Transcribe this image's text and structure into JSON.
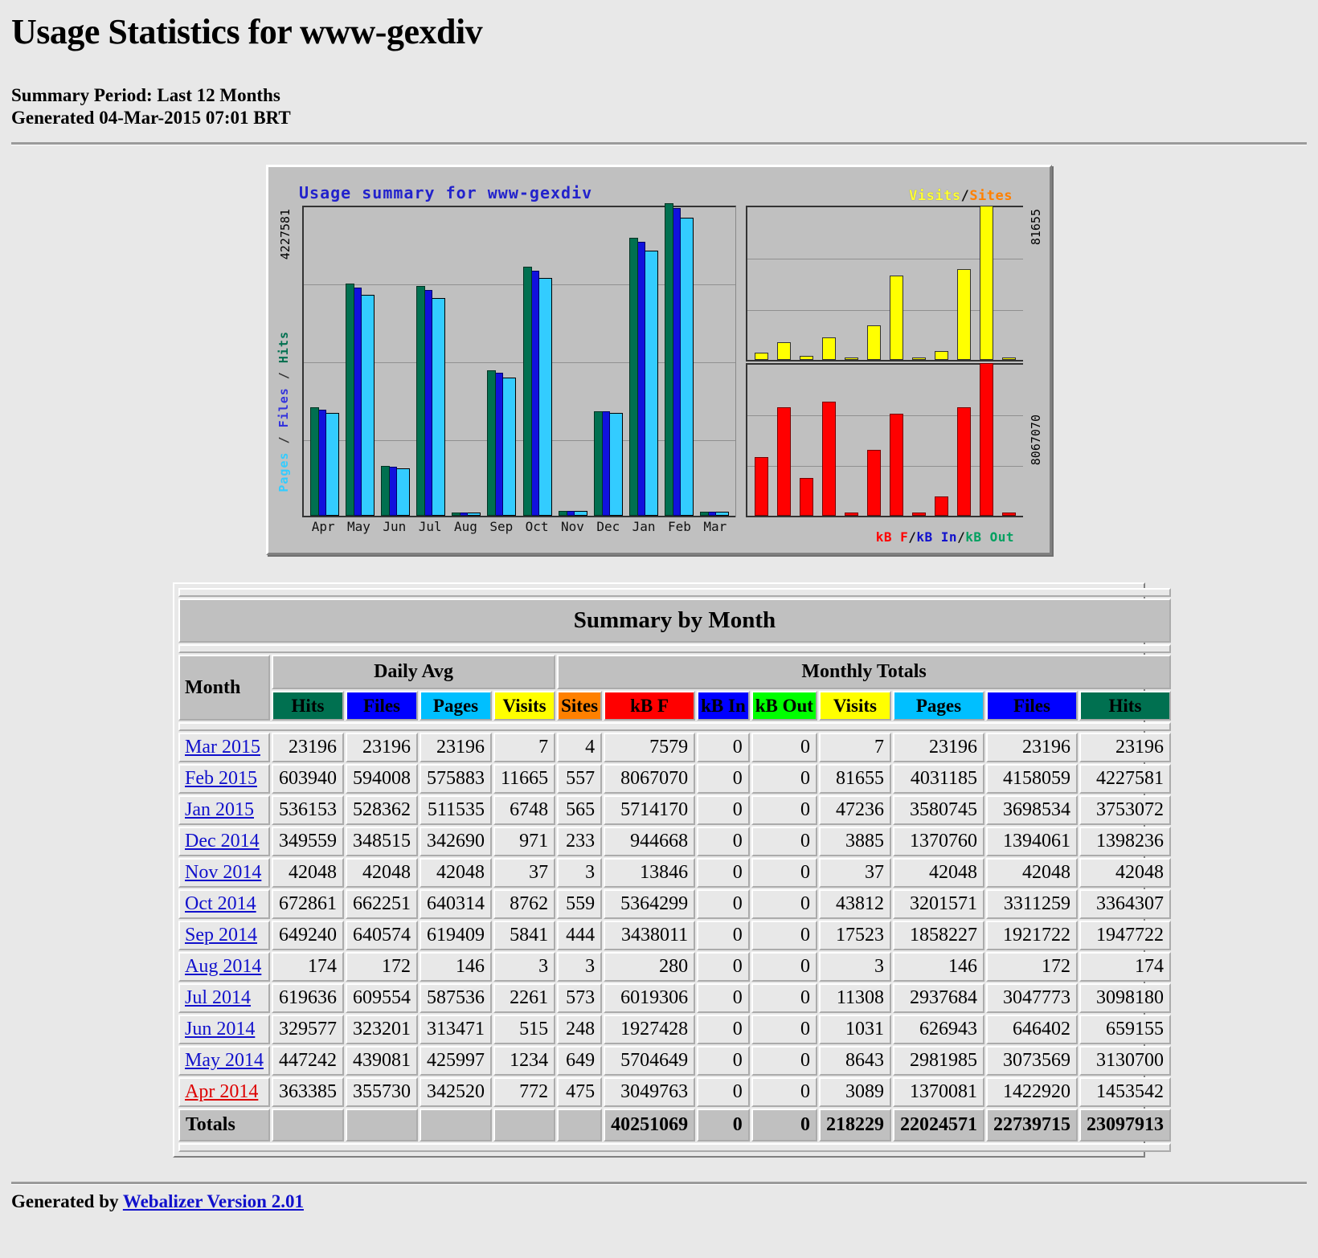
{
  "page": {
    "title": "Usage Statistics for www-gexdiv",
    "summary_period": "Summary Period: Last 12 Months",
    "generated": "Generated 04-Mar-2015 07:01 BRT"
  },
  "chart": {
    "title": "Usage summary for www-gexdiv",
    "legend_visits": "Visits",
    "legend_sep": "/",
    "legend_sites": "Sites",
    "legend_kbf": "kB F",
    "legend_kbin": "kB In",
    "legend_kbout": "kB Out",
    "ylabel_pages": "Pages",
    "ylabel_files": "Files",
    "ylabel_hits": "Hits",
    "ylabel_sep": " / ",
    "ymax_left": "4227581",
    "ymax_right_top": "81655",
    "ymax_right_bottom": "8067070"
  },
  "chart_data": {
    "type": "bar",
    "title": "Usage summary for www-gexdiv",
    "xlabel": "",
    "ylabel": "Pages / Files / Hits",
    "categories": [
      "Apr",
      "May",
      "Jun",
      "Jul",
      "Aug",
      "Sep",
      "Oct",
      "Nov",
      "Dec",
      "Jan",
      "Feb",
      "Mar"
    ],
    "grid": true,
    "legend_position": "top-right",
    "panels": [
      {
        "name": "Pages / Files / Hits",
        "ylim": [
          0,
          4227581
        ],
        "series": [
          {
            "name": "Hits",
            "color": "#007050",
            "values": [
              1453542,
              3130700,
              659155,
              3098180,
              174,
              1947722,
              3364307,
              42048,
              1398236,
              3753072,
              4227581,
              23196
            ]
          },
          {
            "name": "Files",
            "color": "#1111DD",
            "values": [
              1422920,
              3073569,
              646402,
              3047773,
              172,
              1921722,
              3311259,
              42048,
              1394061,
              3698534,
              4158059,
              23196
            ]
          },
          {
            "name": "Pages",
            "color": "#33CCFF",
            "values": [
              1370081,
              2981985,
              626943,
              2937684,
              146,
              1858227,
              3201571,
              42048,
              1370760,
              3580745,
              4031185,
              23196
            ]
          }
        ]
      },
      {
        "name": "Visits / Sites",
        "ylim": [
          0,
          81655
        ],
        "series": [
          {
            "name": "Visits",
            "color": "#FFFF00",
            "values": [
              3089,
              8643,
              1031,
              11308,
              3,
              17523,
              43812,
              37,
              3885,
              47236,
              81655,
              7
            ]
          },
          {
            "name": "Sites",
            "color": "#FF8000",
            "values": [
              475,
              649,
              248,
              573,
              3,
              444,
              559,
              3,
              233,
              565,
              557,
              4
            ]
          }
        ]
      },
      {
        "name": "kB F / kB In / kB Out",
        "ylim": [
          0,
          8067070
        ],
        "series": [
          {
            "name": "kB F",
            "color": "#FF0000",
            "values": [
              3049763,
              5704649,
              1927428,
              6019306,
              280,
              3438011,
              5364299,
              13846,
              944668,
              5714170,
              8067070,
              7579
            ]
          },
          {
            "name": "kB In",
            "color": "#1111CC",
            "values": [
              0,
              0,
              0,
              0,
              0,
              0,
              0,
              0,
              0,
              0,
              0,
              0
            ]
          },
          {
            "name": "kB Out",
            "color": "#00A060",
            "values": [
              0,
              0,
              0,
              0,
              0,
              0,
              0,
              0,
              0,
              0,
              0,
              0
            ]
          }
        ]
      }
    ]
  },
  "table": {
    "caption": "Summary by Month",
    "group_headers": {
      "daily_avg": "Daily Avg",
      "monthly_totals": "Monthly Totals"
    },
    "month_header": "Month",
    "columns": [
      {
        "label": "Hits",
        "bg": "#007050",
        "fg": "#000000"
      },
      {
        "label": "Files",
        "bg": "#0000FF",
        "fg": "#000000"
      },
      {
        "label": "Pages",
        "bg": "#00BFFF",
        "fg": "#000000"
      },
      {
        "label": "Visits",
        "bg": "#FFFF00",
        "fg": "#000000"
      },
      {
        "label": "Sites",
        "bg": "#FF8000",
        "fg": "#000000"
      },
      {
        "label": "kB F",
        "bg": "#FF0000",
        "fg": "#000000"
      },
      {
        "label": "kB In",
        "bg": "#0000FF",
        "fg": "#000000"
      },
      {
        "label": "kB Out",
        "bg": "#00FF00",
        "fg": "#000000"
      },
      {
        "label": "Visits",
        "bg": "#FFFF00",
        "fg": "#000000"
      },
      {
        "label": "Pages",
        "bg": "#00BFFF",
        "fg": "#000000"
      },
      {
        "label": "Files",
        "bg": "#0000FF",
        "fg": "#000000"
      },
      {
        "label": "Hits",
        "bg": "#007050",
        "fg": "#000000"
      }
    ],
    "rows": [
      {
        "month": "Mar 2015",
        "link_color": "#1111CC",
        "cells": [
          "23196",
          "23196",
          "23196",
          "7",
          "4",
          "7579",
          "0",
          "0",
          "7",
          "23196",
          "23196",
          "23196"
        ]
      },
      {
        "month": "Feb 2015",
        "link_color": "#1111CC",
        "cells": [
          "603940",
          "594008",
          "575883",
          "11665",
          "557",
          "8067070",
          "0",
          "0",
          "81655",
          "4031185",
          "4158059",
          "4227581"
        ]
      },
      {
        "month": "Jan 2015",
        "link_color": "#1111CC",
        "cells": [
          "536153",
          "528362",
          "511535",
          "6748",
          "565",
          "5714170",
          "0",
          "0",
          "47236",
          "3580745",
          "3698534",
          "3753072"
        ]
      },
      {
        "month": "Dec 2014",
        "link_color": "#1111CC",
        "cells": [
          "349559",
          "348515",
          "342690",
          "971",
          "233",
          "944668",
          "0",
          "0",
          "3885",
          "1370760",
          "1394061",
          "1398236"
        ]
      },
      {
        "month": "Nov 2014",
        "link_color": "#1111CC",
        "cells": [
          "42048",
          "42048",
          "42048",
          "37",
          "3",
          "13846",
          "0",
          "0",
          "37",
          "42048",
          "42048",
          "42048"
        ]
      },
      {
        "month": "Oct 2014",
        "link_color": "#1111CC",
        "cells": [
          "672861",
          "662251",
          "640314",
          "8762",
          "559",
          "5364299",
          "0",
          "0",
          "43812",
          "3201571",
          "3311259",
          "3364307"
        ]
      },
      {
        "month": "Sep 2014",
        "link_color": "#1111CC",
        "cells": [
          "649240",
          "640574",
          "619409",
          "5841",
          "444",
          "3438011",
          "0",
          "0",
          "17523",
          "1858227",
          "1921722",
          "1947722"
        ]
      },
      {
        "month": "Aug 2014",
        "link_color": "#1111CC",
        "cells": [
          "174",
          "172",
          "146",
          "3",
          "3",
          "280",
          "0",
          "0",
          "3",
          "146",
          "172",
          "174"
        ]
      },
      {
        "month": "Jul 2014",
        "link_color": "#1111CC",
        "cells": [
          "619636",
          "609554",
          "587536",
          "2261",
          "573",
          "6019306",
          "0",
          "0",
          "11308",
          "2937684",
          "3047773",
          "3098180"
        ]
      },
      {
        "month": "Jun 2014",
        "link_color": "#1111CC",
        "cells": [
          "329577",
          "323201",
          "313471",
          "515",
          "248",
          "1927428",
          "0",
          "0",
          "1031",
          "626943",
          "646402",
          "659155"
        ]
      },
      {
        "month": "May 2014",
        "link_color": "#1111CC",
        "cells": [
          "447242",
          "439081",
          "425997",
          "1234",
          "649",
          "5704649",
          "0",
          "0",
          "8643",
          "2981985",
          "3073569",
          "3130700"
        ]
      },
      {
        "month": "Apr 2014",
        "link_color": "#DD0000",
        "cells": [
          "363385",
          "355730",
          "342520",
          "772",
          "475",
          "3049763",
          "0",
          "0",
          "3089",
          "1370081",
          "1422920",
          "1453542"
        ]
      }
    ],
    "totals": {
      "label": "Totals",
      "kbf": "40251069",
      "kbin": "0",
      "kbout": "0",
      "visits": "218229",
      "pages": "22024571",
      "files": "22739715",
      "hits": "23097913"
    }
  },
  "footer": {
    "generated_by": "Generated by",
    "webalizer": "Webalizer Version 2.01"
  }
}
